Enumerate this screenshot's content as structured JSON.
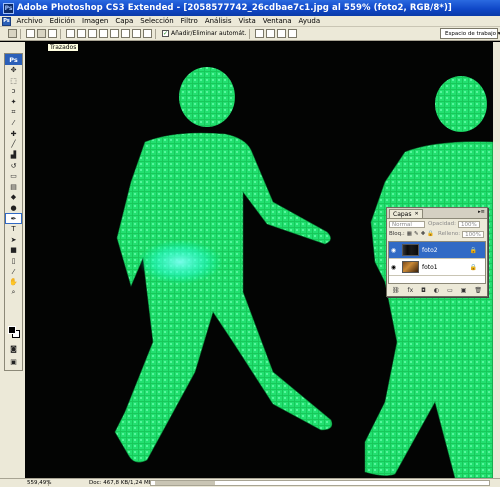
{
  "window": {
    "title": "Adobe Photoshop CS3 Extended - [2058577742_26cdbae7c1.jpg al 559% (foto2, RGB/8*)]",
    "app_badge": "Ps"
  },
  "menu": [
    "Archivo",
    "Edición",
    "Imagen",
    "Capa",
    "Selección",
    "Filtro",
    "Análisis",
    "Vista",
    "Ventana",
    "Ayuda"
  ],
  "options_bar": {
    "add_remove_label": "Añadir/Eliminar automát.",
    "add_remove_checked": true,
    "workspace_label": "Espacio de trabajo ▾"
  },
  "tooltip": "Trazados",
  "toolbox": {
    "badge": "Ps",
    "tools": [
      "move-icon",
      "marquee-icon",
      "lasso-icon",
      "magic-wand-icon",
      "crop-icon",
      "eyedropper-icon",
      "healing-icon",
      "brush-icon",
      "stamp-icon",
      "history-brush-icon",
      "eraser-icon",
      "gradient-icon",
      "blur-icon",
      "dodge-icon",
      "pen-icon",
      "type-icon",
      "path-select-icon",
      "shape-icon",
      "notes-icon",
      "eyedropper2-icon",
      "hand-icon",
      "zoom-icon"
    ],
    "active_tool": "pen-icon",
    "foreground_color": "#000000",
    "background_color": "#ffffff"
  },
  "layers_panel": {
    "tab_label": "Capas",
    "blend_mode": "Normal",
    "opacity_label": "Opacidad:",
    "opacity_value": "100%",
    "lock_label": "Bloq.:",
    "fill_label": "Relleno:",
    "fill_value": "100%",
    "layers": [
      {
        "name": "foto2",
        "selected": true,
        "visible": true,
        "locked": true
      },
      {
        "name": "foto1",
        "selected": false,
        "visible": true,
        "locked": true
      }
    ]
  },
  "status_bar": {
    "zoom": "559,49%",
    "doc": "Doc: 467,8 KB/1,24 MB"
  },
  "colors": {
    "title_bar": "#1048c8",
    "chrome": "#ece9d8",
    "figure_green": "#19d462",
    "figure_cyan": "#36ffe2",
    "selection_blue": "#316ac5"
  }
}
